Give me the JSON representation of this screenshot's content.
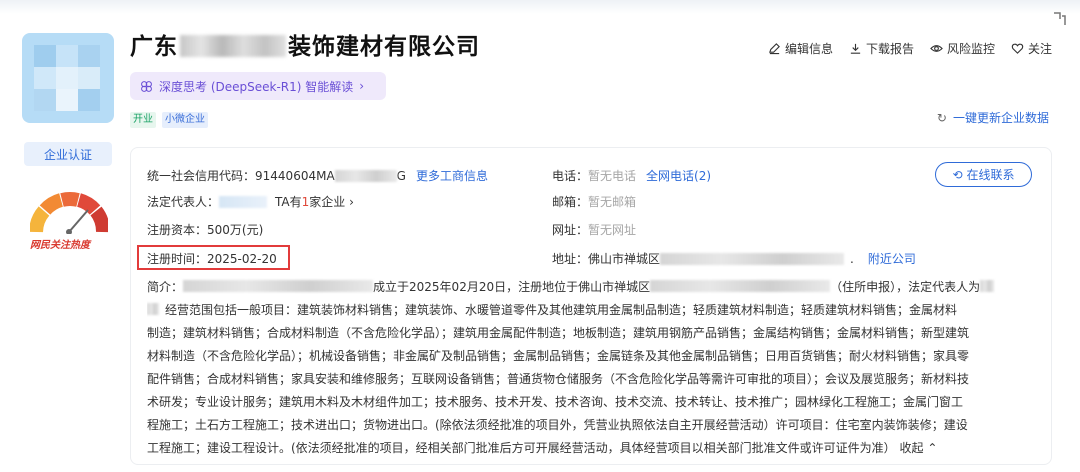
{
  "company": {
    "title_prefix": "广东",
    "title_suffix": "装饰建材有限公司",
    "logo_chars": "",
    "tags": [
      "开业",
      "小微企业"
    ]
  },
  "actions": [
    {
      "label": "编辑信息",
      "icon": "edit-icon"
    },
    {
      "label": "下载报告",
      "icon": "download-icon"
    },
    {
      "label": "风险监控",
      "icon": "eye-icon"
    },
    {
      "label": "关注",
      "icon": "heart-icon"
    }
  ],
  "ai": {
    "label": "深度思考 (DeepSeek-R1) 智能解读",
    "chevron": "›"
  },
  "refresh_label": "一键更新企业数据",
  "cert_label": "企业认证",
  "heat_label": "网民关注热度",
  "info": {
    "credit_code_label": "统一社会信用代码：",
    "credit_code_value": "91440604MA",
    "credit_code_tail": "G",
    "more_info": "更多工商信息",
    "legal_rep_label": "法定代表人：",
    "legal_rep_ta": "TA有",
    "legal_rep_count": "1",
    "legal_rep_suffix": "家企业 ›",
    "capital_label": "注册资本：",
    "capital_value": "500万(元)",
    "reg_time_label": "注册时间：",
    "reg_time_value": "2025-02-20",
    "phone_label": "电话：",
    "phone_value": "暂无电话",
    "phone_all": "全网电话(2)",
    "email_label": "邮箱：",
    "email_value": "暂无邮箱",
    "site_label": "网址：",
    "site_value": "暂无网址",
    "addr_label": "地址：",
    "addr_value": "佛山市禅城区",
    "addr_dot": ".",
    "nearby": "附近公司",
    "contact_btn": "在线联系"
  },
  "intro": {
    "line1_a": "简介：",
    "line1_b": "成立于2025年02月20日，注册地位于佛山市禅城区",
    "line1_c": "（住所申报），法定代表人为",
    "line2": "经营范围包括一般项目：建筑装饰材料销售；建筑装饰、水暖管道零件及其他建筑用金属制品制造；轻质建筑材料制造；轻质建筑材料销售；金属材料",
    "line3": "制造；建筑材料销售；合成材料制造（不含危险化学品）；建筑用金属配件制造；地板制造；建筑用钢筋产品销售；金属结构销售；金属材料销售；新型建筑",
    "line4": "材料制造（不含危险化学品）；机械设备销售；非金属矿及制品销售；金属制品销售；金属链条及其他金属制品销售；日用百货销售；耐火材料销售；家具零",
    "line5": "配件销售；合成材料销售；家具安装和维修服务；互联网设备销售；普通货物仓储服务（不含危险化学品等需许可审批的项目）；会议及展览服务；新材料技",
    "line6": "术研发；专业设计服务；建筑用木料及木材组件加工；技术服务、技术开发、技术咨询、技术交流、技术转让、技术推广；园林绿化工程施工；金属门窗工",
    "line7": "程施工；土石方工程施工；技术进出口；货物进出口。(除依法须经批准的项目外，凭营业执照依法自主开展经营活动）许可项目：住宅室内装饰装修；建设",
    "line8": "工程施工；建设工程设计。(依法须经批准的项目，经相关部门批准后方可开展经营活动，具体经营项目以相关部门批准文件或许可证件为准）",
    "collapse": "收起 ⌃"
  },
  "colors": {
    "link": "#2f6bd8",
    "highlight_box": "#e23b3b",
    "ai_text": "#6a4fd6"
  }
}
